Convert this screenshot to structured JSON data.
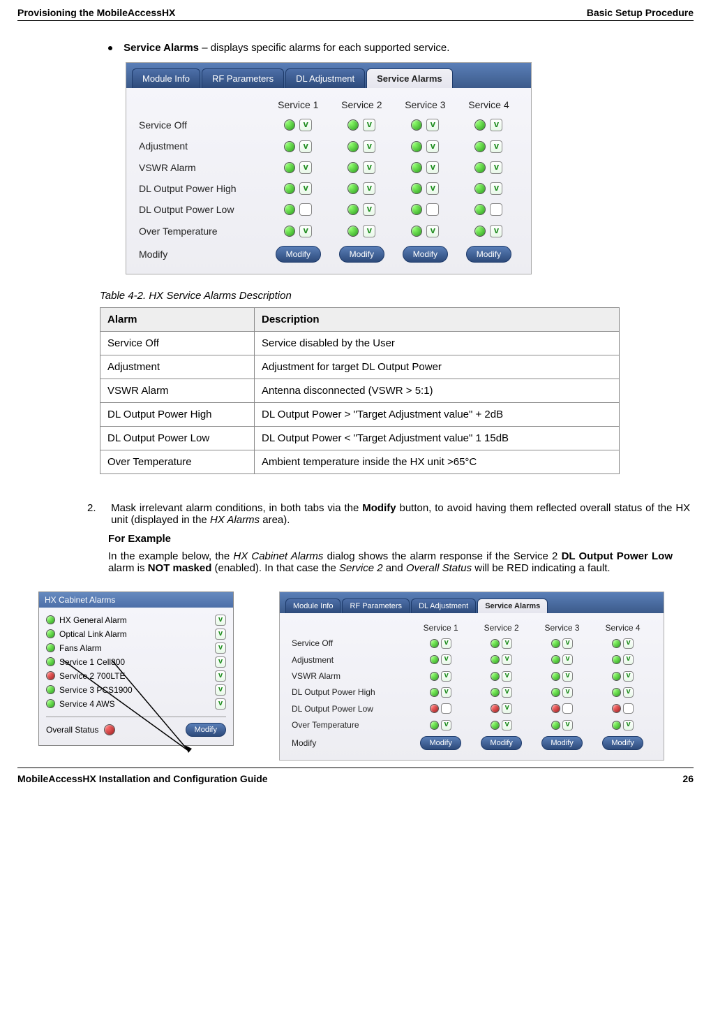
{
  "header": {
    "left": "Provisioning the MobileAccessHX",
    "right": "Basic Setup Procedure"
  },
  "bullet": {
    "title": "Service Alarms",
    "text": " – displays specific alarms for each supported service."
  },
  "tabs": [
    "Module Info",
    "RF Parameters",
    "DL Adjustment",
    "Service Alarms"
  ],
  "svc_cols": [
    "Service 1",
    "Service 2",
    "Service 3",
    "Service 4"
  ],
  "svc_rows": [
    "Service Off",
    "Adjustment",
    "VSWR Alarm",
    "DL Output Power High",
    "DL Output Power Low",
    "Over Temperature",
    "Modify"
  ],
  "panel1_state": [
    [
      [
        true,
        true
      ],
      [
        true,
        true
      ],
      [
        true,
        true
      ],
      [
        true,
        true
      ]
    ],
    [
      [
        true,
        true
      ],
      [
        true,
        true
      ],
      [
        true,
        true
      ],
      [
        true,
        true
      ]
    ],
    [
      [
        true,
        true
      ],
      [
        true,
        true
      ],
      [
        true,
        true
      ],
      [
        true,
        true
      ]
    ],
    [
      [
        true,
        true
      ],
      [
        true,
        true
      ],
      [
        true,
        true
      ],
      [
        true,
        true
      ]
    ],
    [
      [
        true,
        false
      ],
      [
        true,
        true
      ],
      [
        true,
        false
      ],
      [
        true,
        false
      ]
    ],
    [
      [
        true,
        true
      ],
      [
        true,
        true
      ],
      [
        true,
        true
      ],
      [
        true,
        true
      ]
    ]
  ],
  "modify_label": "Modify",
  "caption": "Table 4-2. HX Service Alarms Description",
  "desc_table": {
    "head": [
      "Alarm",
      "Description"
    ],
    "rows": [
      [
        "Service Off",
        "Service disabled by the User"
      ],
      [
        "Adjustment",
        "Adjustment for target DL Output Power"
      ],
      [
        "VSWR Alarm",
        "Antenna disconnected (VSWR > 5:1)"
      ],
      [
        "DL Output Power High",
        "DL Output Power  > \"Target Adjustment value\" + 2dB"
      ],
      [
        "DL Output Power Low",
        "DL Output Power  < \"Target Adjustment value\" 1 15dB"
      ],
      [
        "Over Temperature",
        "Ambient temperature inside the HX unit >65°C"
      ]
    ]
  },
  "step2": {
    "num": "2.",
    "text_pre": "Mask irrelevant alarm conditions, in both tabs via the ",
    "modify": "Modify",
    "text_mid": " button, to avoid having them reflected overall status of the HX unit (displayed in the ",
    "hx_alarms": "HX Alarms",
    "text_end": " area).",
    "for_example": "For Example",
    "ex_pre": "In the example below, the ",
    "ex_i1": "HX Cabinet Alarms",
    "ex_mid1": " dialog shows the alarm response if the Service 2 ",
    "ex_b1": "DL Output Power Low",
    "ex_mid2": " alarm is ",
    "ex_b2": "NOT masked",
    "ex_mid3": " (enabled). In that case the ",
    "ex_i2": "Service 2",
    "ex_mid4": " and ",
    "ex_i3": "Overall Status",
    "ex_end": " will be RED indicating a fault."
  },
  "cabinet": {
    "title": "HX Cabinet Alarms",
    "items": [
      {
        "label": "HX General Alarm",
        "color": "green"
      },
      {
        "label": "Optical Link Alarm",
        "color": "green"
      },
      {
        "label": "Fans Alarm",
        "color": "green"
      },
      {
        "label": "Service 1 Cell800",
        "color": "green"
      },
      {
        "label": "Service 2 700LTE",
        "color": "red"
      },
      {
        "label": "Service 3 PCS1900",
        "color": "green"
      },
      {
        "label": "Service 4 AWS",
        "color": "green"
      }
    ],
    "overall": "Overall Status"
  },
  "panel2_state": [
    [
      [
        true,
        true,
        "g"
      ],
      [
        true,
        true,
        "g"
      ],
      [
        true,
        true,
        "g"
      ],
      [
        true,
        true,
        "g"
      ]
    ],
    [
      [
        true,
        true,
        "g"
      ],
      [
        true,
        true,
        "g"
      ],
      [
        true,
        true,
        "g"
      ],
      [
        true,
        true,
        "g"
      ]
    ],
    [
      [
        true,
        true,
        "g"
      ],
      [
        true,
        true,
        "g"
      ],
      [
        true,
        true,
        "g"
      ],
      [
        true,
        true,
        "g"
      ]
    ],
    [
      [
        true,
        true,
        "g"
      ],
      [
        true,
        true,
        "g"
      ],
      [
        true,
        true,
        "g"
      ],
      [
        true,
        true,
        "g"
      ]
    ],
    [
      [
        true,
        false,
        "r"
      ],
      [
        true,
        true,
        "r"
      ],
      [
        true,
        false,
        "r"
      ],
      [
        true,
        false,
        "r"
      ]
    ],
    [
      [
        true,
        true,
        "g"
      ],
      [
        true,
        true,
        "g"
      ],
      [
        true,
        true,
        "g"
      ],
      [
        true,
        true,
        "g"
      ]
    ]
  ],
  "footer": {
    "left": "MobileAccessHX Installation and Configuration Guide",
    "right": "26"
  }
}
